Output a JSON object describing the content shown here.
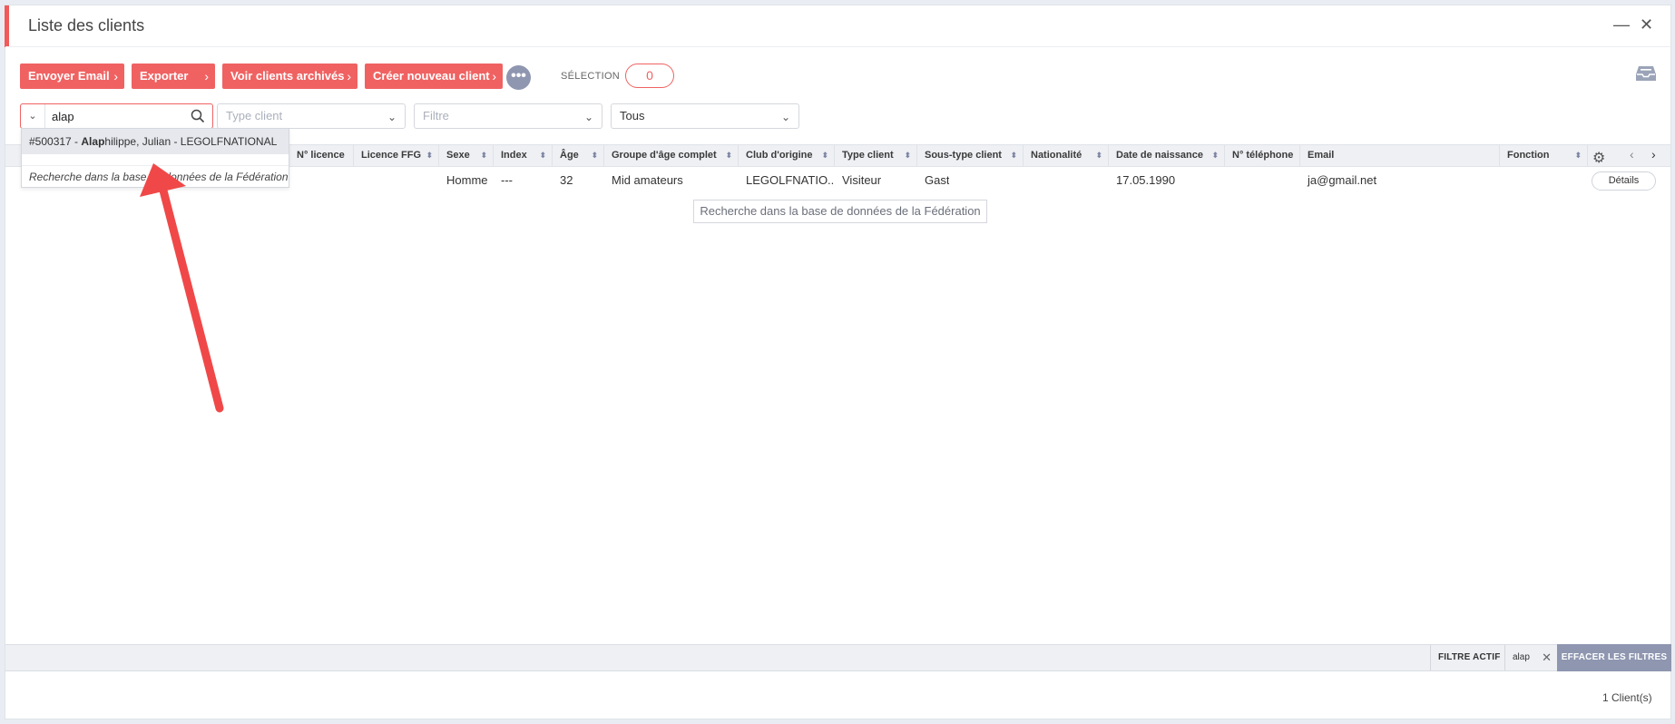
{
  "window": {
    "title": "Liste des clients",
    "minimize_glyph": "—",
    "close_glyph": "✕"
  },
  "toolbar": {
    "buttons": [
      {
        "label": "Envoyer Email"
      },
      {
        "label": "Exporter"
      },
      {
        "label": "Voir clients archivés"
      },
      {
        "label": "Créer nouveau client"
      }
    ],
    "chevron": "›",
    "more_glyph": "•••",
    "selection_label": "SÉLECTION",
    "selection_count": "0",
    "tray_icon": "inbox-tray-icon"
  },
  "filters": {
    "search_value": "alap",
    "type_client_placeholder": "Type client",
    "filtre_placeholder": "Filtre",
    "status_value": "Tous",
    "chevron": "⌄"
  },
  "suggestions": {
    "item_prefix": "#500317 - ",
    "item_match": "Alap",
    "item_rest": "hilippe, Julian - LEGOLFNATIONAL",
    "federation_search": "Recherche dans la base de données de la Fédération"
  },
  "grid": {
    "columns": [
      "N° licence",
      "Licence FFG",
      "Sexe",
      "Index",
      "Âge",
      "Groupe d'âge complet",
      "Club d'origine",
      "Type client",
      "Sous-type client",
      "Nationalité",
      "Date de naissance",
      "N° téléphone",
      "Email",
      "Fonction"
    ],
    "sort_glyph": "⬍",
    "row": {
      "sexe": "Homme",
      "index": "---",
      "age": "32",
      "groupe": "Mid amateurs",
      "club": "LEGOLFNATIO...",
      "type": "Visiteur",
      "soustype": "Gast",
      "naissance": "17.05.1990",
      "email": "ja@gmail.net",
      "details_label": "Détails"
    },
    "federation_search": "Recherche dans la base de données de la Fédération",
    "nav_prev": "‹",
    "nav_next": "›",
    "gear_glyph": "⚙"
  },
  "footer": {
    "filter_active_label": "FILTRE ACTIF",
    "filter_chip": "alap",
    "filter_chip_close": "✕",
    "clear_filters": "EFFACER LES FILTRES",
    "count": "1 Client(s)"
  },
  "colors": {
    "accent": "#f06262",
    "muted_button": "#8e96b0",
    "annotation_arrow": "#f04848"
  }
}
